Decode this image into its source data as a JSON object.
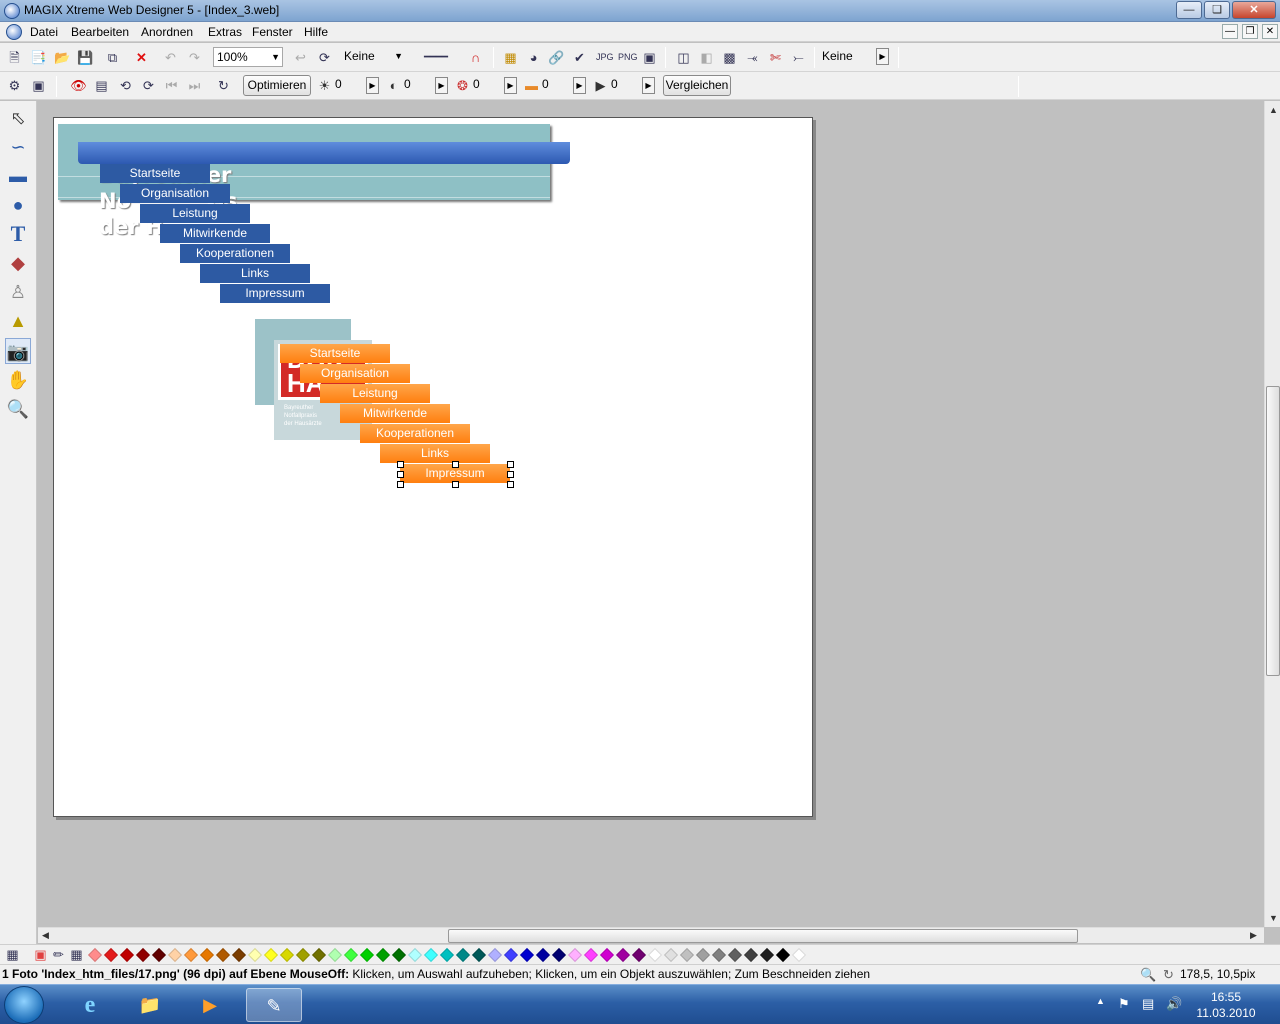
{
  "window": {
    "title": "MAGIX Xtreme Web Designer 5 - [Index_3.web]"
  },
  "menu": {
    "items": [
      "Datei",
      "Bearbeiten",
      "Anordnen",
      "Extras",
      "Fenster",
      "Hilfe"
    ]
  },
  "toolbar1": {
    "zoom": "100%",
    "fill_select": "Keine",
    "right_select": "Keine"
  },
  "toolbar2": {
    "optimize_label": "Optimieren",
    "brightness": "0",
    "contrast": "0",
    "saturation": "0",
    "hue": "0",
    "sharpen": "0",
    "compare_label": "Vergleichen"
  },
  "canvas": {
    "site_title": "Bayreuther\nNo          xis\nder H",
    "nav_blue": [
      "Startseite",
      "Organisation",
      "Leistung",
      "Mitwirkende",
      "Kooperationen",
      "Links",
      "Impressum"
    ],
    "nav_orange": [
      "Startseite",
      "Organisation",
      "Leistung",
      "Mitwirkende",
      "Kooperationen",
      "Links",
      "Impressum"
    ],
    "logo_text_1": "DOK",
    "logo_text_2": "HA",
    "logo_small": "Bayreuther\nNotfallpraxis\nder Hausärzte"
  },
  "colors": {
    "nav_blue": "#2d5aa3",
    "nav_orange": "#ff8a1f",
    "banner_teal": "#8ec0c5",
    "palette": [
      "#ff8c8c",
      "#e31b1b",
      "#c00000",
      "#900000",
      "#600000",
      "#ffd2a6",
      "#ff9a3c",
      "#e67800",
      "#b05a00",
      "#7a3c00",
      "#ffffb0",
      "#ffff20",
      "#d8d800",
      "#a0a000",
      "#707000",
      "#b0ffb0",
      "#40ff40",
      "#00d000",
      "#00a000",
      "#007000",
      "#b0ffff",
      "#40ffff",
      "#00c0c0",
      "#008888",
      "#005858",
      "#b0b0ff",
      "#4040ff",
      "#0000d0",
      "#0000a0",
      "#000070",
      "#ffb0ff",
      "#ff40ff",
      "#d000d0",
      "#a000a0",
      "#700070",
      "#ffffff",
      "#e0e0e0",
      "#c0c0c0",
      "#a0a0a0",
      "#808080",
      "#606060",
      "#404040",
      "#202020",
      "#000000",
      "#ffffff"
    ]
  },
  "status": {
    "text": "1 Foto 'Index_htm_files/17.png' (96 dpi) auf Ebene MouseOff:",
    "hint": " Klicken, um Auswahl aufzuheben; Klicken, um ein Objekt auszuwählen; Zum Beschneiden ziehen",
    "coords": "178,5, 10,5pix"
  },
  "taskbar": {
    "time": "16:55",
    "date": "11.03.2010"
  }
}
